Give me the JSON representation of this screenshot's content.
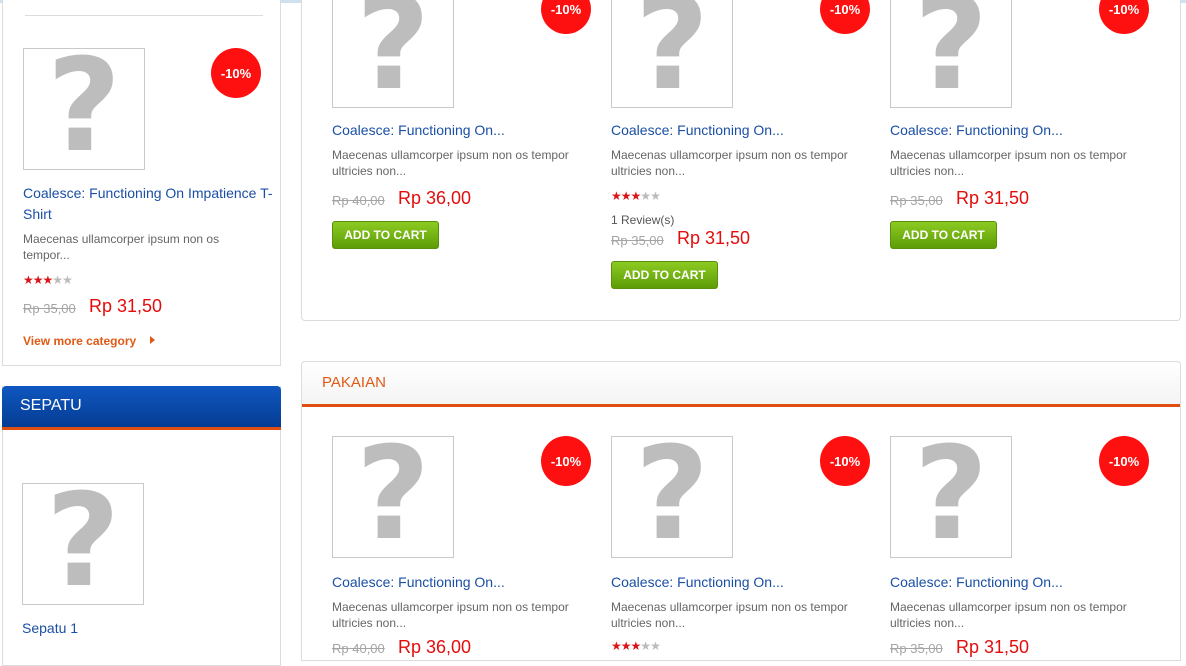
{
  "badge_text": "-10%",
  "add_to_cart_label": "ADD TO CART",
  "colors": {
    "accent_orange": "#e05a14",
    "sale_red": "#e30d0d",
    "badge_red": "#ff1010",
    "link_blue": "#1a4fa5",
    "cart_green": "#6fae12",
    "header_blue": "#0a4aae"
  },
  "left_featured": {
    "title": "Coalesce: Functioning On Impatience T-Shirt",
    "desc": "Maecenas ullamcorper ipsum non os tempor...",
    "rating": 3,
    "old_price": "Rp 35,00",
    "new_price": "Rp 31,50",
    "view_more": "View more category"
  },
  "sepatu": {
    "heading": "SEPATU",
    "product_title": "Sepatu 1"
  },
  "top_products": [
    {
      "title": "Coalesce: Functioning On...",
      "desc_line1": "Maecenas ullamcorper ipsum non os tempor",
      "desc_line2": "ultricies non...",
      "old_price": "Rp 40,00",
      "new_price": "Rp 36,00"
    },
    {
      "title": "Coalesce: Functioning On...",
      "desc_line1": "Maecenas ullamcorper ipsum non os tempor",
      "desc_line2": "ultricies non...",
      "rating": 3,
      "reviews": "1 Review(s)",
      "old_price": "Rp 35,00",
      "new_price": "Rp 31,50"
    },
    {
      "title": "Coalesce: Functioning On...",
      "desc_line1": "Maecenas ullamcorper ipsum non os tempor",
      "desc_line2": "ultricies non...",
      "old_price": "Rp 35,00",
      "new_price": "Rp 31,50"
    }
  ],
  "pakaian": {
    "heading": "PAKAIAN",
    "products": [
      {
        "title": "Coalesce: Functioning On...",
        "desc_line1": "Maecenas ullamcorper ipsum non os tempor",
        "desc_line2": "ultricies non...",
        "old_price": "Rp 40,00",
        "new_price": "Rp 36,00"
      },
      {
        "title": "Coalesce: Functioning On...",
        "desc_line1": "Maecenas ullamcorper ipsum non os tempor",
        "desc_line2": "ultricies non...",
        "rating": 3
      },
      {
        "title": "Coalesce: Functioning On...",
        "desc_line1": "Maecenas ullamcorper ipsum non os tempor",
        "desc_line2": "ultricies non...",
        "old_price": "Rp 35,00",
        "new_price": "Rp 31,50"
      }
    ]
  }
}
